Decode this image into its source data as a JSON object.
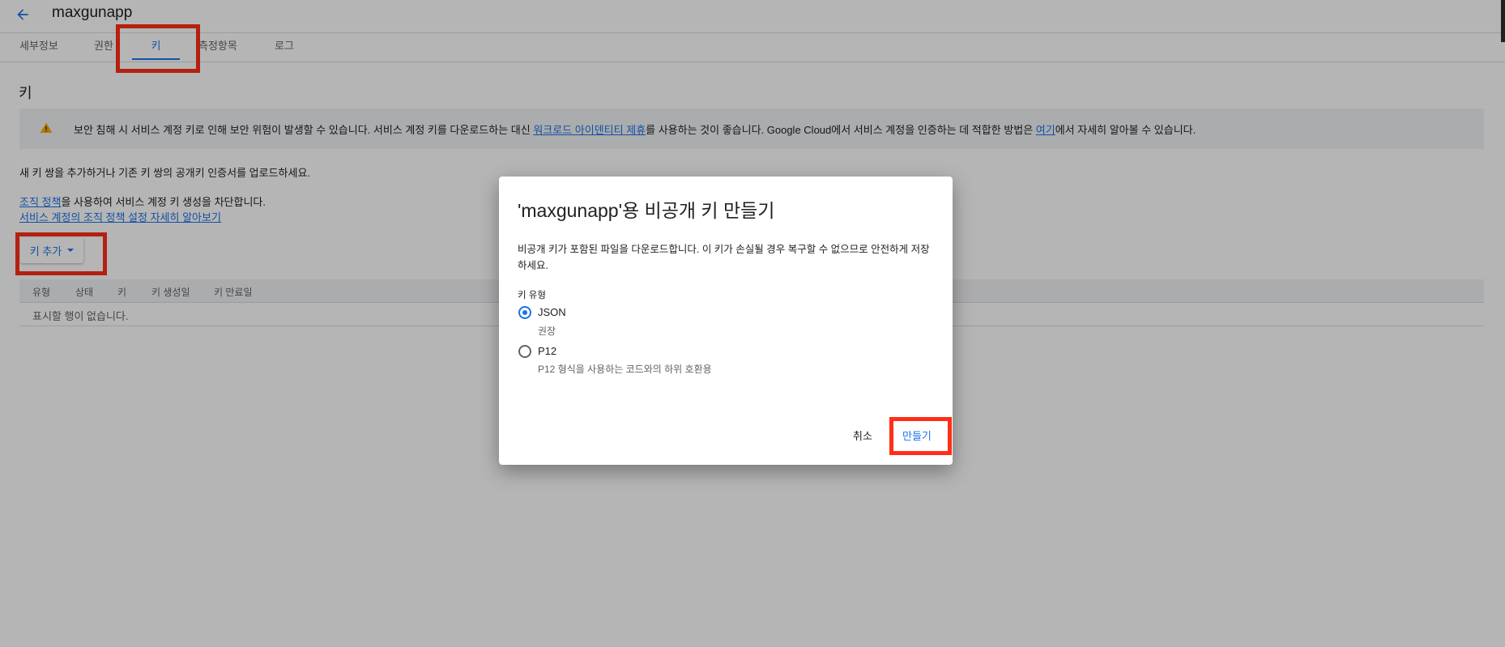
{
  "header": {
    "title": "maxgunapp"
  },
  "tabs": [
    {
      "label": "세부정보"
    },
    {
      "label": "권한"
    },
    {
      "label": "키"
    },
    {
      "label": "측정항목"
    },
    {
      "label": "로그"
    }
  ],
  "page": {
    "section_title": "키",
    "warning": {
      "text_before_link1": "보안 침해 시 서비스 계정 키로 인해 보안 위험이 발생할 수 있습니다. 서비스 계정 키를 다운로드하는 대신 ",
      "link1": "워크로드 아이덴티티 제휴",
      "text_after_link1": "를 사용하는 것이 좋습니다. Google Cloud에서 서비스 계정을 인증하는 데 적합한 방법은 ",
      "link2": "여기",
      "text_after_link2": "에서 자세히 알아볼 수 있습니다."
    },
    "description": "새 키 쌍을 추가하거나 기존 키 쌍의 공개키 인증서를 업로드하세요.",
    "policy_link": "조직 정책",
    "policy_text": "을 사용하여 서비스 계정 키 생성을 차단합니다.",
    "policy_learn_more": "서비스 계정의 조직 정책 설정 자세히 알아보기",
    "add_key_label": "키 추가",
    "table": {
      "columns": [
        "유형",
        "상태",
        "키",
        "키 생성일",
        "키 만료일"
      ],
      "empty_message": "표시할 행이 없습니다."
    }
  },
  "dialog": {
    "title": "'maxgunapp'용 비공개 키 만들기",
    "description": "비공개 키가 포함된 파일을 다운로드합니다. 이 키가 손실될 경우 복구할 수 없으므로 안전하게 저장하세요.",
    "key_type_label": "키 유형",
    "options": [
      {
        "label": "JSON",
        "sub": "권장",
        "selected": true
      },
      {
        "label": "P12",
        "sub": "P12 형식을 사용하는 코드와의 하위 호환용",
        "selected": false
      }
    ],
    "cancel_label": "취소",
    "create_label": "만들기"
  },
  "colors": {
    "accent": "#1a73e8",
    "highlight_box": "#ff2e17",
    "warning_icon": "#f9ab00"
  }
}
